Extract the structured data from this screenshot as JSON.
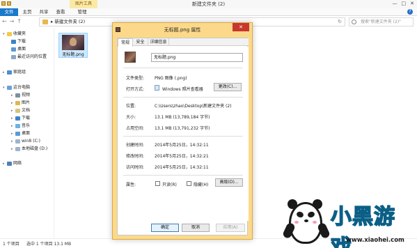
{
  "window": {
    "title": "新建文件夹 (2)",
    "context_tab": "图片工具",
    "controls": [
      "—",
      "□",
      "✕"
    ]
  },
  "ribbon": {
    "tabs": [
      "文件",
      "主页",
      "共享",
      "查看",
      "管理"
    ]
  },
  "address": {
    "nav": [
      "←",
      "→",
      "↑"
    ],
    "path": "▸  新建文件夹 (2)",
    "search_placeholder": "搜索\"新建文件夹 (2)\""
  },
  "sidebar": {
    "favorites": {
      "label": "收藏夹",
      "items": [
        "下载",
        "桌面",
        "最近访问的位置"
      ]
    },
    "homegroup": "家庭组",
    "thispc": {
      "label": "这台电脑",
      "items": [
        "视频",
        "图片",
        "文档",
        "下载",
        "音乐",
        "桌面",
        "win8 (C:)",
        "本地磁盘 (D:)"
      ]
    },
    "network": "网络"
  },
  "file": {
    "name": "无标题.png"
  },
  "status": {
    "count": "1 个项目",
    "selected": "选中 1 个项目  13.1 MB"
  },
  "dialog": {
    "title": "无标题.png 属性",
    "close": "✕",
    "tabs": [
      "常规",
      "安全",
      "详细信息"
    ],
    "filename": "无标题.png",
    "rows": {
      "type_label": "文件类型:",
      "type_value": "PNG 图像 (.png)",
      "open_label": "打开方式:",
      "open_value": "Windows 照片查看器",
      "change_btn": "更改(C)...",
      "loc_label": "位置:",
      "loc_value": "C:\\Users\\zhao\\Desktop\\新建文件夹 (2)",
      "size_label": "大小:",
      "size_value": "13.1 MB (13,789,184 字节)",
      "disk_label": "占用空间:",
      "disk_value": "13.1 MB (13,791,232 字节)",
      "created_label": "创建时间:",
      "created_value": "2014年5月25日，14:32:11",
      "modified_label": "修改时间:",
      "modified_value": "2014年5月25日，14:32:21",
      "accessed_label": "访问时间:",
      "accessed_value": "2014年5月25日，14:32:11",
      "attr_label": "属性:",
      "readonly": "只读(R)",
      "hidden": "隐藏(H)",
      "advanced_btn": "高级(D)..."
    },
    "buttons": {
      "ok": "确定",
      "cancel": "取消",
      "apply": "应用(A)"
    }
  },
  "watermark": {
    "logo_text": "小黑游戏",
    "url": "www.xiaohei.com"
  },
  "colors": {
    "file_tab": "#1979ca",
    "dialog_frame": "#fcd98a",
    "close": "#c7372e",
    "selection": "#cce8ff",
    "logo": "#17a3d8"
  }
}
